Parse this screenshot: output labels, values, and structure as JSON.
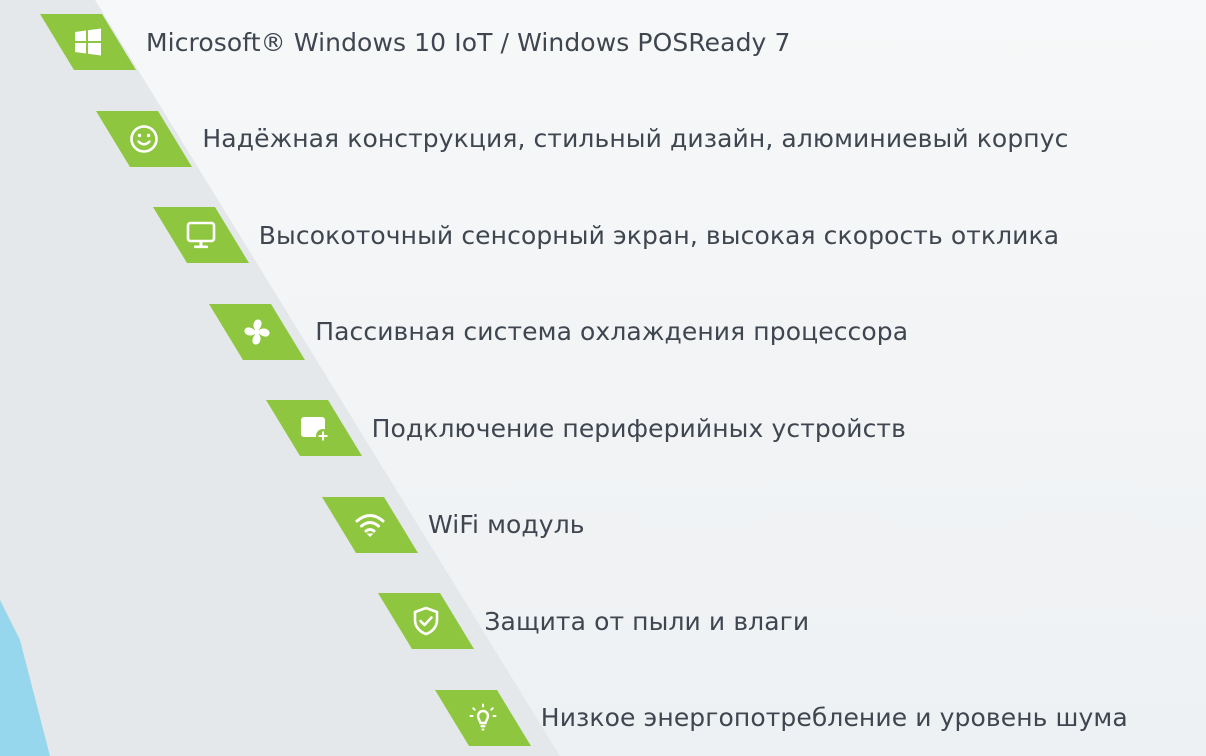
{
  "theme": {
    "accent": "#8fc63f",
    "text": "#3f4650",
    "band": "#e3e7ea",
    "corner": "#8ad3ee"
  },
  "features": [
    {
      "label": "Microsoft® Windows 10 IoT / Windows POSReady 7",
      "icon": "windows-logo-icon"
    },
    {
      "label": "Надёжная конструкция, стильный дизайн, алюминиевый корпус",
      "icon": "smiley-icon"
    },
    {
      "label": "Высокоточный сенсорный экран, высокая скорость отклика",
      "icon": "monitor-icon"
    },
    {
      "label": "Пассивная система охлаждения процессора",
      "icon": "fan-icon"
    },
    {
      "label": "Подключение периферийных устройств",
      "icon": "add-device-icon"
    },
    {
      "label": "WiFi модуль",
      "icon": "wifi-icon"
    },
    {
      "label": "Защита от пыли и влаги",
      "icon": "shield-check-icon"
    },
    {
      "label": "Низкое энергопотребление и уровень шума",
      "icon": "lightbulb-icon"
    }
  ]
}
